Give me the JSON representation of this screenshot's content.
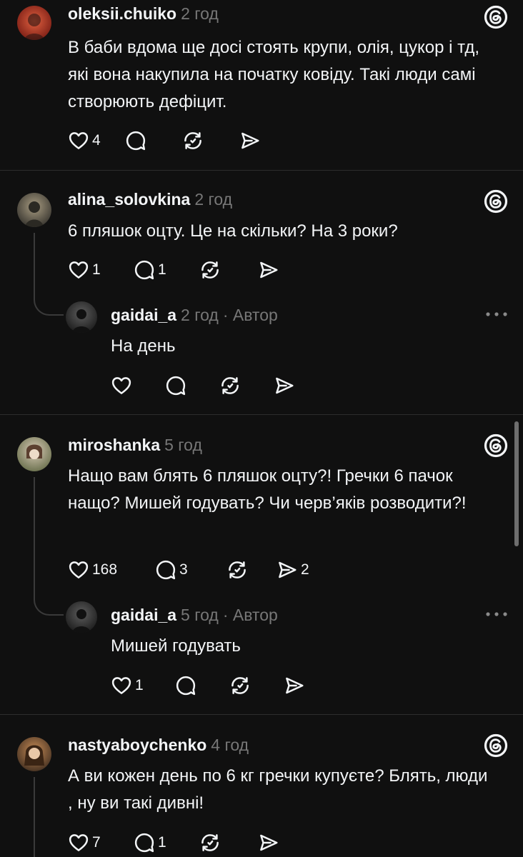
{
  "colors": {
    "background": "#101010",
    "text": "#f3f5f7",
    "muted": "#777777",
    "divider": "#2d2d2d"
  },
  "posts": [
    {
      "username": "oleksii.chuiko",
      "time": "2 год",
      "text": "В баби вдома ще досі стоять крупи, олія, цукор і тд, які вона накупила на початку ковіду. Такі люди самі створюють дефіцит.",
      "likes": "4",
      "replies": "",
      "reposts": "",
      "shares": ""
    },
    {
      "username": "alina_solovkina",
      "time": "2 год",
      "text": "6 пляшок оцту. Це на скільки? На 3 роки?",
      "likes": "1",
      "replies": "1",
      "reposts": "",
      "shares": "",
      "reply": {
        "username": "gaidai_a",
        "time": "2 год",
        "author": "· Автор",
        "text": "На день",
        "likes": "",
        "replies": "",
        "reposts": "",
        "shares": ""
      }
    },
    {
      "username": "miroshanka",
      "time": "5 год",
      "text": "Нащо вам блять 6 пляшок оцту?! Гречки 6 пачок нащо? Мишей годувать? Чи черв’яків розводити?!",
      "likes": "168",
      "replies": "3",
      "reposts": "",
      "shares": "2",
      "reply": {
        "username": "gaidai_a",
        "time": "5 год",
        "author": "· Автор",
        "text": "Мишей годувать",
        "likes": "1",
        "replies": "",
        "reposts": "",
        "shares": ""
      }
    },
    {
      "username": "nastyaboychenko",
      "time": "4 год",
      "text": "А ви кожен день по 6 кг гречки купуєте? Блять, люди , ну ви такі дивні!",
      "likes": "7",
      "replies": "1",
      "reposts": "",
      "shares": ""
    }
  ],
  "icons": {
    "like": "heart-icon",
    "reply": "comment-bubble-icon",
    "repost": "repost-icon",
    "share": "send-icon",
    "logo": "threads-logo-icon",
    "more": "more-dots-icon",
    "avatar": "avatar"
  }
}
